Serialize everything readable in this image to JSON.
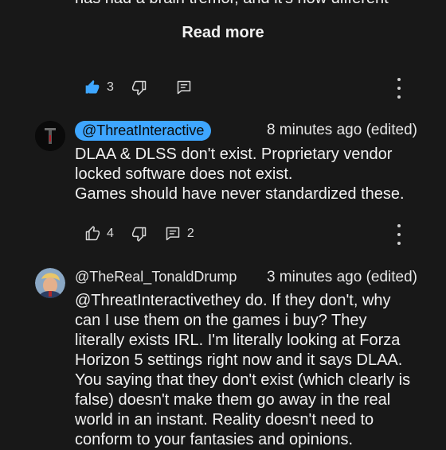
{
  "prev_comment": {
    "cut_text": "has had a brain tremor, and it's now different",
    "read_more_label": "Read more",
    "likes": "3",
    "liked": true
  },
  "comment1": {
    "handle": "@ThreatInteractive",
    "timestamp": "8 minutes ago (edited)",
    "text": "DLAA & DLSS don't exist. Proprietary vendor\nlocked software does not exist.\nGames should have never standardized these.",
    "likes": "4",
    "replies": "2"
  },
  "comment2": {
    "handle": "@TheReal_TonaldDrump",
    "timestamp": "3 minutes ago (edited)",
    "text": "@ThreatInteractivethey do. If they don't, why\ncan I use them on the games i buy? They\nliterally exists IRL. I'm literally looking at Forza\nHorizon 5 settings right now and it says DLAA.\nYou saying that they don't exist (which clearly is\nfalse) doesn't make them go away in the real\nworld in an instant. Reality doesn't need to\nconform to your fantasies and opinions."
  },
  "colors": {
    "background": "#181818",
    "accent": "#3ea6ff",
    "text": "#f1f1f1"
  }
}
